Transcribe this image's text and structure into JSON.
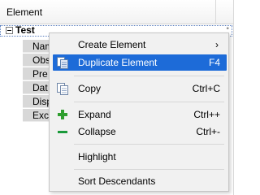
{
  "grid": {
    "header_label": "Element",
    "root_node": "Test",
    "root_more": "°",
    "children": [
      "Name",
      "Obs",
      "Pre",
      "Dat",
      "Disp",
      "Exc"
    ]
  },
  "context_menu": {
    "create_element": "Create Element",
    "create_element_arrow": "›",
    "duplicate_element": "Duplicate Element",
    "duplicate_shortcut": "F4",
    "copy": "Copy",
    "copy_shortcut": "Ctrl+C",
    "expand": "Expand",
    "expand_shortcut": "Ctrl++",
    "collapse": "Collapse",
    "collapse_shortcut": "Ctrl+-",
    "highlight": "Highlight",
    "sort_descendants": "Sort Descendants"
  },
  "colors": {
    "selection": "#1d6bd8",
    "menu_background": "#f1f1f1",
    "child_cell_background": "#d8d8d8",
    "add_icon": "#2f9e2f",
    "remove_icon": "#1a9a3a"
  },
  "icons": {
    "duplicate": "duplicate-icon",
    "copy": "copy-icon",
    "expand": "plus-icon",
    "collapse": "minus-icon",
    "tree_toggle": "collapse-toggle-icon"
  }
}
